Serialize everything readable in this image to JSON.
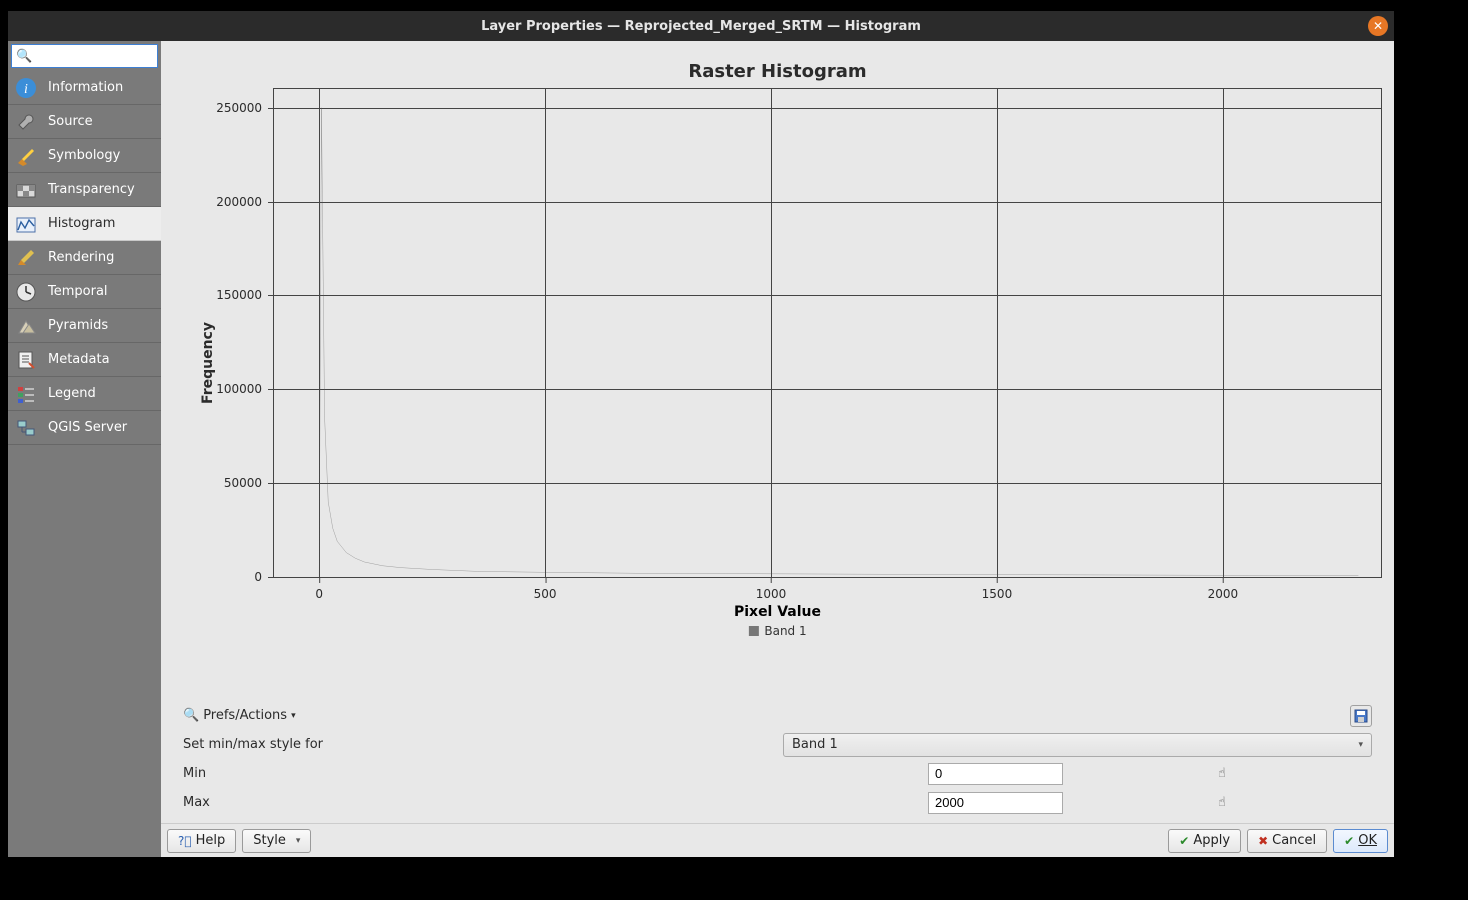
{
  "window": {
    "title": "Layer Properties — Reprojected_Merged_SRTM — Histogram"
  },
  "sidebar": {
    "search_placeholder": "",
    "items": [
      {
        "label": "Information",
        "icon": "info"
      },
      {
        "label": "Source",
        "icon": "source"
      },
      {
        "label": "Symbology",
        "icon": "symbology"
      },
      {
        "label": "Transparency",
        "icon": "transparency"
      },
      {
        "label": "Histogram",
        "icon": "histogram"
      },
      {
        "label": "Rendering",
        "icon": "rendering"
      },
      {
        "label": "Temporal",
        "icon": "temporal"
      },
      {
        "label": "Pyramids",
        "icon": "pyramids"
      },
      {
        "label": "Metadata",
        "icon": "metadata"
      },
      {
        "label": "Legend",
        "icon": "legend"
      },
      {
        "label": "QGIS Server",
        "icon": "server"
      }
    ],
    "active_index": 4
  },
  "chart_data": {
    "type": "line",
    "title": "Raster Histogram",
    "xlabel": "Pixel Value",
    "ylabel": "Frequency",
    "xlim": [
      -100,
      2350
    ],
    "ylim": [
      0,
      260000
    ],
    "x_ticks": [
      0,
      500,
      1000,
      1500,
      2000
    ],
    "y_ticks": [
      0,
      50000,
      100000,
      150000,
      200000,
      250000
    ],
    "series": [
      {
        "name": "Band 1",
        "color": "#555555",
        "x": [
          0,
          5,
          12,
          20,
          30,
          40,
          60,
          80,
          100,
          140,
          180,
          250,
          350,
          500,
          700,
          900,
          1200,
          1600,
          2000,
          2300
        ],
        "y": [
          0,
          250000,
          85000,
          40000,
          26000,
          19000,
          13000,
          10000,
          8000,
          6000,
          5000,
          4000,
          3000,
          2500,
          2000,
          1800,
          1500,
          1200,
          900,
          700
        ]
      }
    ],
    "legend": {
      "position": "bottom",
      "items": [
        "Band 1"
      ]
    }
  },
  "controls": {
    "prefs_label": "Prefs/Actions",
    "set_minmax_label": "Set min/max style for",
    "band_value": "Band 1",
    "min_label": "Min",
    "min_value": "0",
    "max_label": "Max",
    "max_value": "2000"
  },
  "footer": {
    "help": "Help",
    "style": "Style",
    "apply": "Apply",
    "cancel": "Cancel",
    "ok": "OK"
  }
}
